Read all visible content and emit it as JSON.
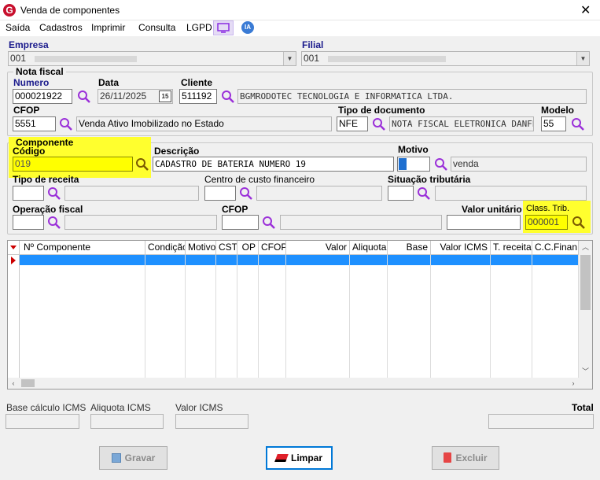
{
  "window": {
    "title": "Venda de componentes",
    "close": "✕",
    "app_icon": "G"
  },
  "menu": {
    "items": [
      "Saída",
      "Cadastros",
      "Imprimir",
      "Consulta",
      "LGPD"
    ],
    "ia_badge": "IA"
  },
  "empresa": {
    "label": "Empresa",
    "value": "001"
  },
  "filial": {
    "label": "Filial",
    "value": "001"
  },
  "nota_fiscal": {
    "group_title": "Nota fiscal",
    "numero_label": "Numero",
    "numero": "000021922",
    "data_label": "Data",
    "data": "26/11/2025",
    "calendar": "15",
    "cliente_label": "Cliente",
    "cliente_codigo": "511192",
    "cliente_nome": "BGMRODOTEC TECNOLOGIA E INFORMATICA LTDA.",
    "cfop_label": "CFOP",
    "cfop": "5551",
    "cfop_desc": "Venda Ativo Imobilizado no Estado",
    "tipo_doc_label": "Tipo de documento",
    "tipo_doc": "NFE",
    "tipo_doc_desc": "NOTA FISCAL ELETRONICA DANFE",
    "modelo_label": "Modelo",
    "modelo": "55"
  },
  "componente": {
    "group_title": "Componente",
    "codigo_label": "Código",
    "codigo": "019",
    "descricao_label": "Descrição",
    "descricao": "CADASTRO DE BATERIA NUMERO 19",
    "motivo_label": "Motivo",
    "motivo_desc": "venda",
    "tipo_receita_label": "Tipo de receita",
    "centro_custo_label": "Centro de custo financeiro",
    "situacao_trib_label": "Situação tributária",
    "operacao_fiscal_label": "Operação fiscal",
    "cfop_label": "CFOP",
    "valor_unitario_label": "Valor unitário",
    "class_trib_label": "Class. Trib.",
    "class_trib": "000001"
  },
  "grid": {
    "columns": [
      "Nº Componente",
      "Condição",
      "Motivo",
      "CST",
      "OP",
      "CFOP",
      "Valor",
      "Aliquota",
      "Base",
      "Valor ICMS",
      "T. receita",
      "C.C.Finan"
    ]
  },
  "totals": {
    "base_calculo_label": "Base cálculo ICMS",
    "aliquota_label": "Aliquota ICMS",
    "valor_icms_label": "Valor ICMS",
    "total_label": "Total"
  },
  "buttons": {
    "gravar": "Gravar",
    "limpar": "Limpar",
    "excluir": "Excluir"
  },
  "colors": {
    "highlight": "#ffff00",
    "selection": "#1e90ff",
    "search_icon": "#9b30d9",
    "lgpd_icon": "#8a2be2",
    "ia_badge": "#3a7bd5",
    "header_blue": "#1a1a8c"
  }
}
